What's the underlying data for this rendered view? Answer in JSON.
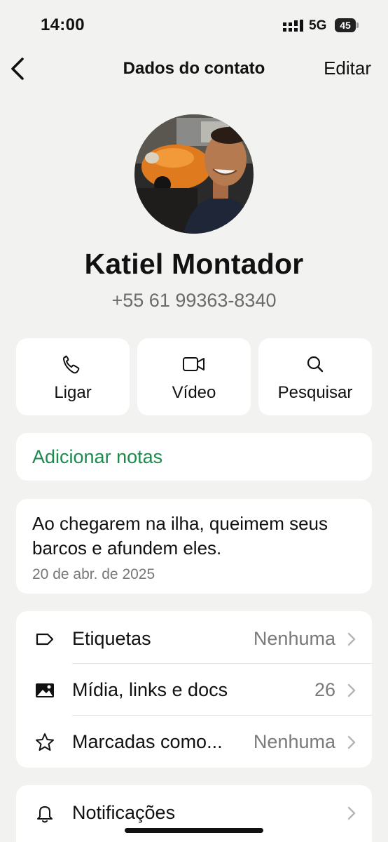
{
  "status_bar": {
    "time": "14:00",
    "network": "5G",
    "battery": "45"
  },
  "header": {
    "title": "Dados do contato",
    "edit_label": "Editar"
  },
  "profile": {
    "name": "Katiel Montador",
    "phone": "+55 61 99363-8340"
  },
  "actions": [
    {
      "label": "Ligar",
      "icon": "phone-icon"
    },
    {
      "label": "Vídeo",
      "icon": "video-icon"
    },
    {
      "label": "Pesquisar",
      "icon": "search-icon"
    }
  ],
  "notes": {
    "label": "Adicionar notas"
  },
  "about": {
    "text": "Ao chegarem na ilha, queimem seus barcos e afundem eles.",
    "date": "20 de abr. de 2025"
  },
  "details": [
    {
      "label": "Etiquetas",
      "value": "Nenhuma",
      "icon": "tag-icon"
    },
    {
      "label": "Mídia, links e docs",
      "value": "26",
      "icon": "image-icon"
    },
    {
      "label": "Marcadas como...",
      "value": "Nenhuma",
      "icon": "star-icon"
    }
  ],
  "notifications": {
    "label": "Notificações",
    "icon": "bell-icon"
  },
  "colors": {
    "accent_green": "#1e8a4f",
    "background": "#f2f2f1"
  }
}
